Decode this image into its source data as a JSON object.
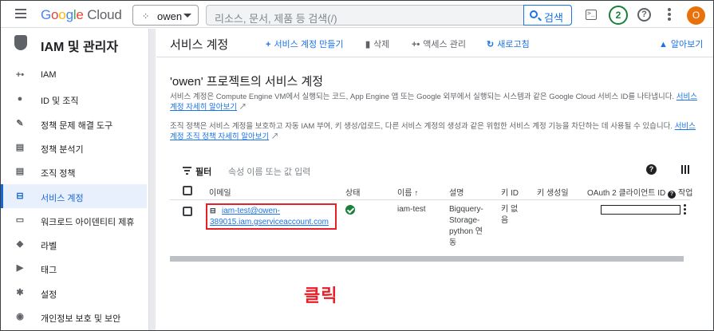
{
  "topbar": {
    "logo_google": "Google",
    "logo_cloud": " Cloud",
    "project_name": "owen",
    "search_placeholder": "리소스, 문서, 제품 등 검색(/)",
    "search_button": "검색",
    "notification_count": "2",
    "avatar_initial": "O"
  },
  "sidebar": {
    "title": "IAM 및 관리자",
    "items": [
      {
        "label": "IAM",
        "icon": "person-add-icon",
        "glyph": "+•"
      },
      {
        "label": "ID 및 조직",
        "icon": "account-circle-icon",
        "glyph": "●"
      },
      {
        "label": "정책 문제 해결 도구",
        "icon": "wrench-icon",
        "glyph": "✎"
      },
      {
        "label": "정책 분석기",
        "icon": "policy-analyzer-icon",
        "glyph": "▤"
      },
      {
        "label": "조직 정책",
        "icon": "article-icon",
        "glyph": "▤"
      },
      {
        "label": "서비스 계정",
        "icon": "service-account-icon",
        "glyph": "⊟"
      },
      {
        "label": "워크로드 아이덴티티 제휴",
        "icon": "badge-icon",
        "glyph": "▭"
      },
      {
        "label": "라벨",
        "icon": "label-icon",
        "glyph": "◆"
      },
      {
        "label": "태그",
        "icon": "tag-icon",
        "glyph": "▶"
      },
      {
        "label": "설정",
        "icon": "gear-icon",
        "glyph": "✱"
      },
      {
        "label": "개인정보 보호 및 보안",
        "icon": "shield-icon",
        "glyph": "◉"
      }
    ],
    "active_index": 5
  },
  "toolbar": {
    "title": "서비스 계정",
    "create_label": "서비스 계정 만들기",
    "delete_label": "삭제",
    "access_label": "액세스 관리",
    "refresh_label": "새로고침",
    "learn_label": "알아보기"
  },
  "content": {
    "heading": "'owen' 프로젝트의 서비스 계정",
    "para1_text": "서비스 계정은 Compute Engine VM에서 실행되는 코드, App Engine 앱 또는 Google 외부에서 실행되는 시스템과 같은 Google Cloud 서비스 ID를 나타냅니다. ",
    "para1_link": "서비스 계정 자세히 알아보기",
    "para2_text": "조직 정책은 서비스 계정을 보호하고 자동 IAM 부여, 키 생성/업로드, 다른 서비스 계정의 생성과 같은 위험한 서비스 계정 기능을 차단하는 데 사용될 수 있습니다. ",
    "para2_link": "서비스 계정 조직 정책 자세히 알아보기"
  },
  "filter": {
    "label": "필터",
    "placeholder": "속성 이름 또는 값 입력"
  },
  "table": {
    "headers": {
      "email": "이메일",
      "status": "상태",
      "name": "이름",
      "description": "설명",
      "key_id": "키 ID",
      "key_created": "키 생성일",
      "oauth_client_id": "OAuth 2 클라이언트 ID",
      "actions": "작업"
    },
    "rows": [
      {
        "email": "iam-test@owen-389015.iam.gserviceaccount.com",
        "name": "iam-test",
        "description": "Bigquery-Storage-python 연동",
        "key_id": "키 없음"
      }
    ]
  },
  "annotation": {
    "click_label": "클릭",
    "highlight_color": "#e5202a"
  },
  "colors": {
    "accent": "#1a73e8",
    "success": "#188038",
    "avatar": "#e8710a"
  }
}
